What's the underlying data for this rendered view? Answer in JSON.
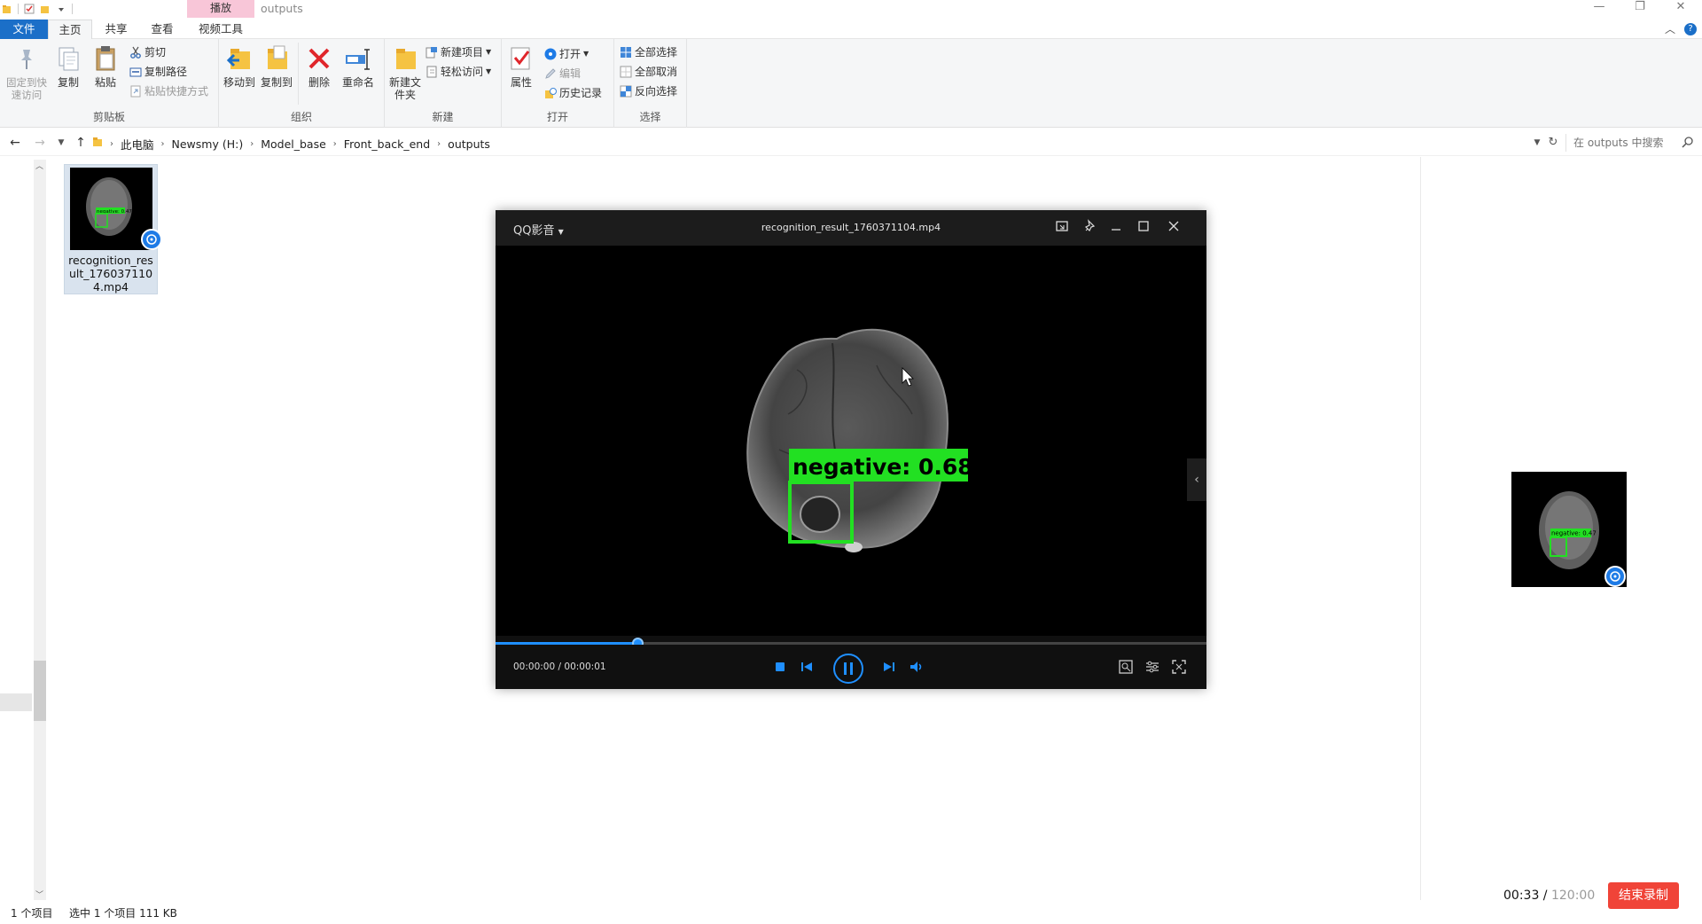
{
  "title_bar": {
    "context_tab": "播放",
    "window_title": "outputs",
    "minimize": "—",
    "restore": "❐",
    "close": "✕"
  },
  "ribbon_tabs": [
    "文件",
    "主页",
    "共享",
    "查看",
    "视频工具"
  ],
  "ribbon": {
    "clipboard": {
      "group_label": "剪贴板",
      "pin_label": "固定到快速访问",
      "copy_label": "复制",
      "paste_label": "粘贴",
      "cut_label": "剪切",
      "copy_path_label": "复制路径",
      "paste_shortcut_label": "粘贴快捷方式"
    },
    "organize": {
      "group_label": "组织",
      "move_to_label": "移动到",
      "copy_to_label": "复制到",
      "delete_label": "删除",
      "rename_label": "重命名"
    },
    "new": {
      "group_label": "新建",
      "new_folder_label": "新建文件夹",
      "new_item_label": "新建项目",
      "easy_access_label": "轻松访问"
    },
    "open": {
      "group_label": "打开",
      "properties_label": "属性",
      "open_label": "打开",
      "edit_label": "编辑",
      "history_label": "历史记录"
    },
    "select": {
      "group_label": "选择",
      "select_all_label": "全部选择",
      "select_none_label": "全部取消",
      "invert_label": "反向选择"
    }
  },
  "address": {
    "crumbs": [
      "此电脑",
      "Newsmy (H:)",
      "Model_base",
      "Front_back_end",
      "outputs"
    ],
    "search_placeholder": "在 outputs 中搜索"
  },
  "file": {
    "name": "recognition_result_1760371104.mp4",
    "overlay_text": "negative: 0.47"
  },
  "player": {
    "brand": "QQ影音",
    "file_title": "recognition_result_1760371104.mp4",
    "time_current": "00:00:00",
    "time_sep": " / ",
    "time_total": "00:00:01",
    "progress": 0.2,
    "detection_label": "negative: 0.68"
  },
  "status": {
    "item_count": "1 个项目",
    "selected": "选中 1 个项目  111 KB"
  },
  "recorder": {
    "elapsed": "00:33",
    "limit": "120:00",
    "sep": " / ",
    "stop_label": "结束录制"
  },
  "colors": {
    "accent": "#1b6fc8",
    "context_tab": "#f8c6d8",
    "player_accent": "#1f8fff",
    "detection_box": "#22e022",
    "stop_button": "#f04438"
  }
}
